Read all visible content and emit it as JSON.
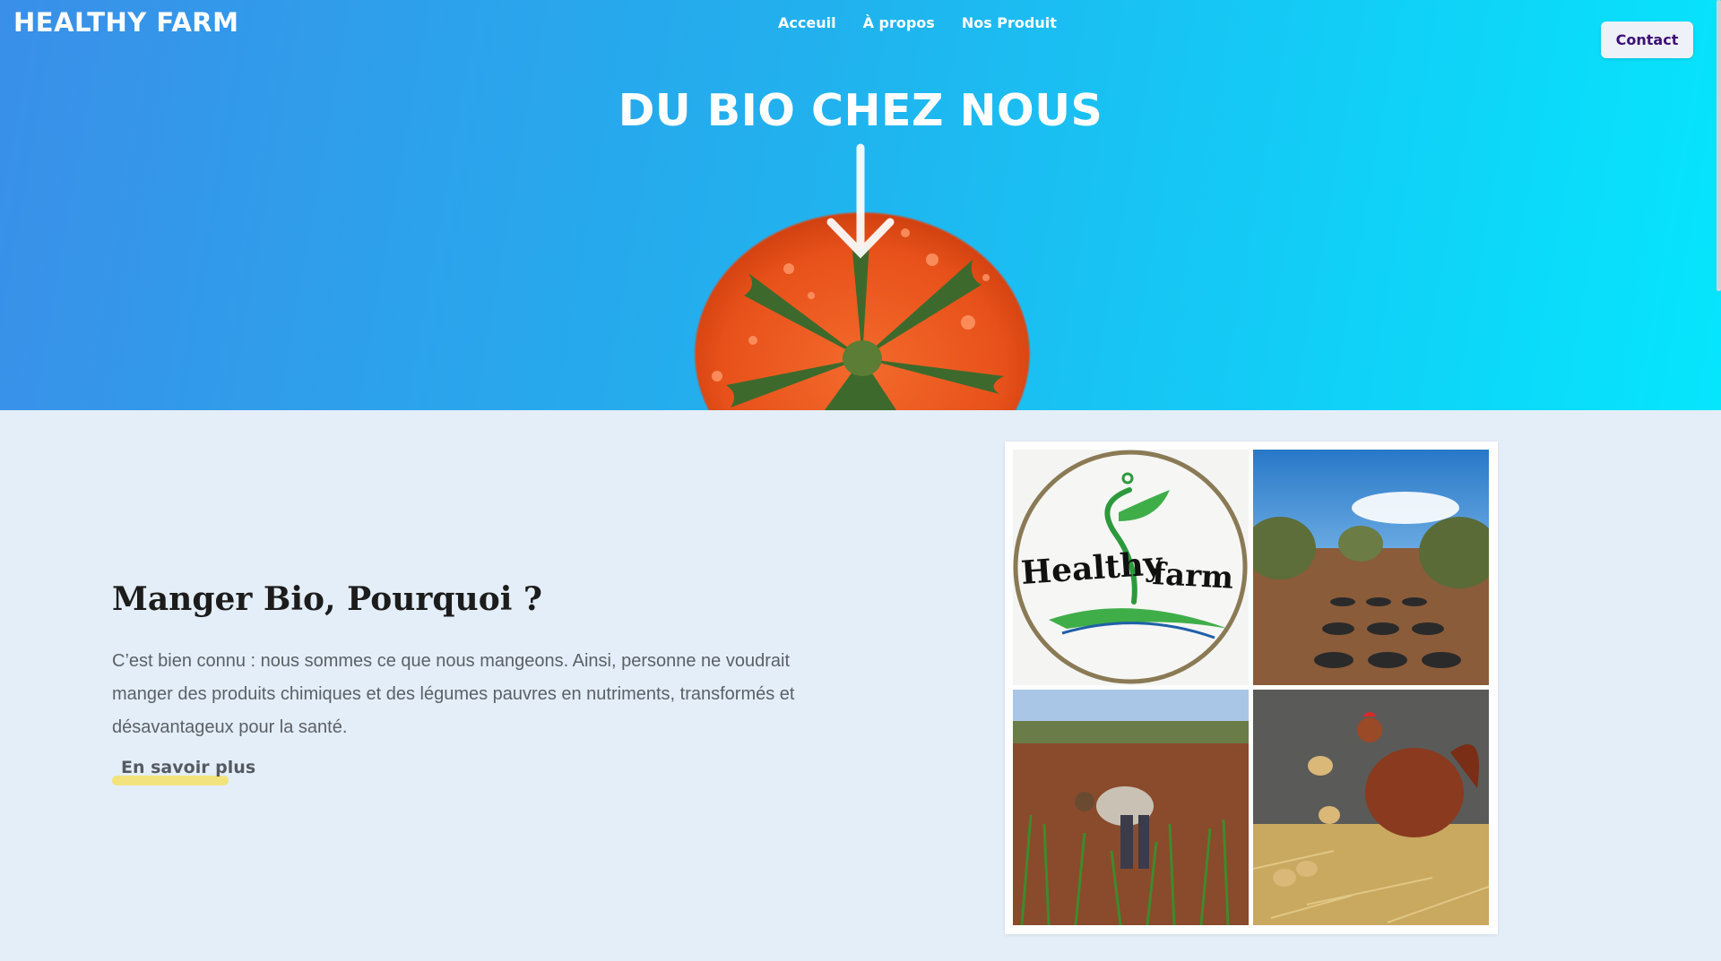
{
  "header": {
    "brand": "HEALTHY FARM",
    "nav": [
      {
        "label": "Acceuil"
      },
      {
        "label": "À propos"
      },
      {
        "label": "Nos Produit"
      }
    ],
    "contact_label": "Contact"
  },
  "hero": {
    "title": "DU BIO CHEZ NOUS",
    "icons": [
      "arrow-down-icon",
      "tomato-image"
    ]
  },
  "about": {
    "title": "Manger Bio, Pourquoi ?",
    "text": "C’est bien connu : nous sommes ce que nous mangeons. Ainsi, personne ne voudrait manger des produits chimiques et des légumes pauvres en nutriments, transformés et désavantageux pour la santé.",
    "link_label": "En savoir plus"
  },
  "collage": {
    "logo_word_1": "Healthy",
    "logo_word_2": "farm",
    "tiles": [
      "logo-tile",
      "olive-field-tile",
      "farmer-tile",
      "chickens-tile"
    ]
  },
  "colors": {
    "hero_start": "#3a8fe8",
    "hero_end": "#05e6fd",
    "highlight": "#f2e37d",
    "contact_text": "#3d0f74",
    "page_bg": "#e4eef8"
  }
}
